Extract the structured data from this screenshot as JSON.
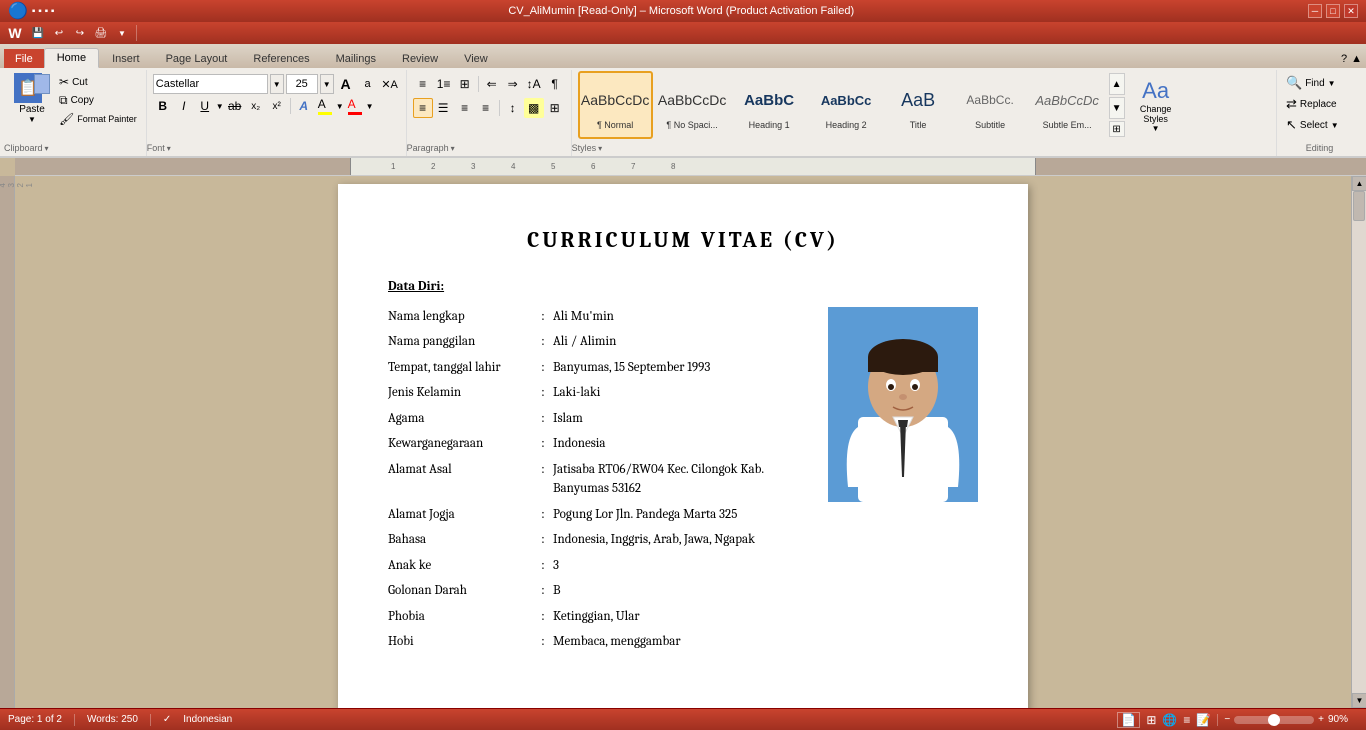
{
  "titlebar": {
    "text": "CV_AliMumin [Read-Only] – Microsoft Word (Product Activation Failed)",
    "min_btn": "─",
    "max_btn": "□",
    "close_btn": "✕"
  },
  "quickaccess": {
    "save_label": "💾",
    "undo_label": "↩",
    "redo_label": "↪",
    "print_label": "🖨"
  },
  "tabs": [
    {
      "id": "file",
      "label": "File"
    },
    {
      "id": "home",
      "label": "Home",
      "active": true
    },
    {
      "id": "insert",
      "label": "Insert"
    },
    {
      "id": "page-layout",
      "label": "Page Layout"
    },
    {
      "id": "references",
      "label": "References"
    },
    {
      "id": "mailings",
      "label": "Mailings"
    },
    {
      "id": "review",
      "label": "Review"
    },
    {
      "id": "view",
      "label": "View"
    }
  ],
  "ribbon": {
    "clipboard": {
      "paste_label": "Paste",
      "cut_label": "Cut",
      "copy_label": "Copy",
      "format_painter_label": "Format Painter"
    },
    "font": {
      "name": "Castellar",
      "size": "25",
      "grow_label": "A",
      "shrink_label": "a",
      "bold_label": "B",
      "italic_label": "I",
      "underline_label": "U",
      "strikethrough_label": "ab",
      "subscript_label": "x₂",
      "superscript_label": "x²",
      "clear_label": "A",
      "highlight_label": "A",
      "color_label": "A"
    },
    "paragraph_label": "Paragraph",
    "styles": {
      "label": "Styles",
      "items": [
        {
          "id": "normal",
          "label": "¶ Normal",
          "active": true,
          "preview_text": "AaBbCcDc"
        },
        {
          "id": "no-spacing",
          "label": "¶ No Spaci...",
          "active": false,
          "preview_text": "AaBbCcDc"
        },
        {
          "id": "heading1",
          "label": "Heading 1",
          "active": false,
          "preview_text": "AaBbC"
        },
        {
          "id": "heading2",
          "label": "Heading 2",
          "active": false,
          "preview_text": "AaBbCc"
        },
        {
          "id": "title",
          "label": "Title",
          "active": false,
          "preview_text": "AaB"
        },
        {
          "id": "subtitle",
          "label": "Subtitle",
          "active": false,
          "preview_text": "AaBbCc."
        },
        {
          "id": "subtle-em",
          "label": "Subtle Em...",
          "active": false,
          "preview_text": "AaBbCcDc"
        }
      ],
      "change_styles_label": "Change\nStyles"
    },
    "editing": {
      "label": "Editing",
      "find_label": "Find",
      "replace_label": "Replace",
      "select_label": "Select"
    }
  },
  "document": {
    "title": "CURRICULUM  VITAE  (CV)",
    "data_diri_header": "Data Diri:",
    "fields": [
      {
        "label": "Nama lengkap",
        "sep": ":",
        "value": "Ali Mu'min"
      },
      {
        "label": "Nama panggilan",
        "sep": ":",
        "value": "Ali / Alimin"
      },
      {
        "label": "Tempat, tanggal lahir",
        "sep": ":",
        "value": "Banyumas, 15 September  1993"
      },
      {
        "label": "Jenis Kelamin",
        "sep": ":",
        "value": "Laki-laki"
      },
      {
        "label": "Agama",
        "sep": ":",
        "value": "Islam"
      },
      {
        "label": "Kewarganegaraan",
        "sep": ":",
        "value": "Indonesia"
      },
      {
        "label": "Alamat Asal",
        "sep": ":",
        "value": "Jatisaba RT06/RW04 Kec. Cilongok Kab. Banyumas 53162"
      },
      {
        "label": "Alamat Jogja",
        "sep": ":",
        "value": "Pogung Lor Jln. Pandega Marta 325"
      },
      {
        "label": "Bahasa",
        "sep": ":",
        "value": "Indonesia, Inggris, Arab, Jawa, Ngapak"
      },
      {
        "label": "Anak ke",
        "sep": ":",
        "value": "3"
      },
      {
        "label": "Golonan  Darah",
        "sep": ":",
        "value": "B"
      },
      {
        "label": "Phobia",
        "sep": ":",
        "value": "Ketinggian, Ular"
      },
      {
        "label": "Hobi",
        "sep": ":",
        "value": "Membaca, menggambar"
      }
    ]
  },
  "statusbar": {
    "page_info": "Page: 1 of 2",
    "words_info": "Words: 250",
    "language": "Indonesian",
    "zoom_value": "90%"
  }
}
